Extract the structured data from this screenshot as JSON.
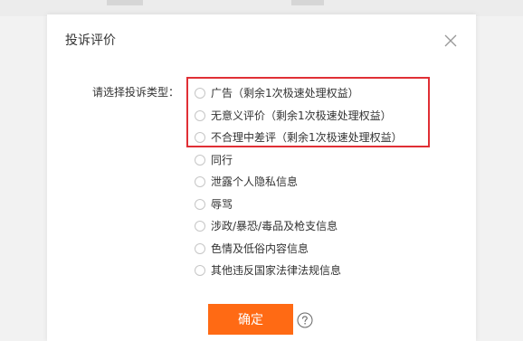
{
  "dialog": {
    "title": "投诉评价"
  },
  "form": {
    "label": "请选择投诉类型：",
    "options": [
      {
        "label": "广告（剩余1次极速处理权益）",
        "selected": false
      },
      {
        "label": "无意义评价（剩余1次极速处理权益）",
        "selected": false
      },
      {
        "label": "不合理中差评（剩余1次极速处理权益）",
        "selected": false
      },
      {
        "label": "同行",
        "selected": false
      },
      {
        "label": "泄露个人隐私信息",
        "selected": false
      },
      {
        "label": "辱骂",
        "selected": false
      },
      {
        "label": "涉政/暴恐/毒品及枪支信息",
        "selected": false
      },
      {
        "label": "色情及低俗内容信息",
        "selected": false
      },
      {
        "label": "其他违反国家法律法规信息",
        "selected": false
      }
    ]
  },
  "actions": {
    "confirm_label": "确定"
  },
  "icons": {
    "close": "close-icon",
    "help": "help-icon",
    "radio": "radio-unchecked-icon"
  },
  "colors": {
    "accent": "#ff6a14",
    "highlight": "#e02f35",
    "text": "#333333",
    "radio_border": "#c6c6c6"
  }
}
